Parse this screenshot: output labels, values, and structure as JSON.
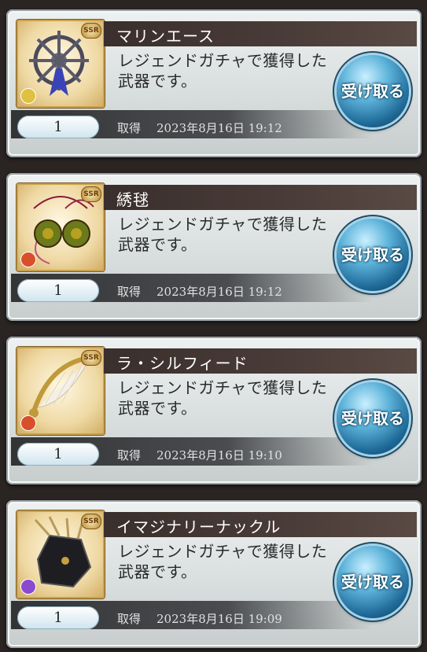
{
  "items": [
    {
      "name": "マリンエース",
      "description": "レジェンドガチャで獲得した武器です。",
      "count": "1",
      "acquired_label": "取得",
      "acquired_at": "2023年8月16日 19:12",
      "rarity": "SSR",
      "element_color": "#e0c040",
      "icon": "ship-wheel-icon",
      "claim_label": "受け取る"
    },
    {
      "name": "綉毬",
      "description": "レジェンドガチャで獲得した武器です。",
      "count": "1",
      "acquired_label": "取得",
      "acquired_at": "2023年8月16日 19:12",
      "rarity": "SSR",
      "element_color": "#d8502a",
      "icon": "embroidered-balls-icon",
      "claim_label": "受け取る"
    },
    {
      "name": "ラ・シルフィード",
      "description": "レジェンドガチャで獲得した武器です。",
      "count": "1",
      "acquired_label": "取得",
      "acquired_at": "2023年8月16日 19:10",
      "rarity": "SSR",
      "element_color": "#d8502a",
      "icon": "harp-weapon-icon",
      "claim_label": "受け取る"
    },
    {
      "name": "イマジナリーナックル",
      "description": "レジェンドガチャで獲得した武器です。",
      "count": "1",
      "acquired_label": "取得",
      "acquired_at": "2023年8月16日 19:09",
      "rarity": "SSR",
      "element_color": "#8a4ad0",
      "icon": "clawed-glove-icon",
      "claim_label": "受け取る"
    }
  ]
}
